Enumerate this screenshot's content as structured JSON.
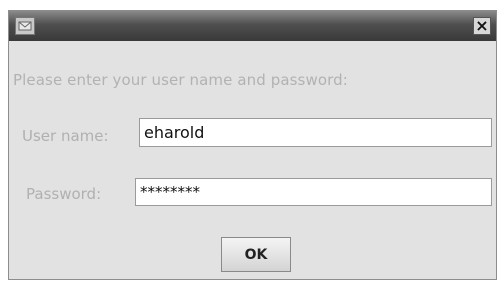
{
  "dialog": {
    "title": "",
    "icon": "dialog-app-icon",
    "close_label": "×",
    "prompt": "Please enter your user name and password:",
    "username": {
      "label": "User name:",
      "value": "eharold"
    },
    "password": {
      "label": "Password:",
      "masked_value": "********"
    },
    "ok_label": "OK"
  },
  "colors": {
    "titlebar": "#4a4a4a",
    "dialog_background": "#e2e2e2",
    "label_text": "#b0b0b0",
    "field_background": "#ffffff"
  }
}
